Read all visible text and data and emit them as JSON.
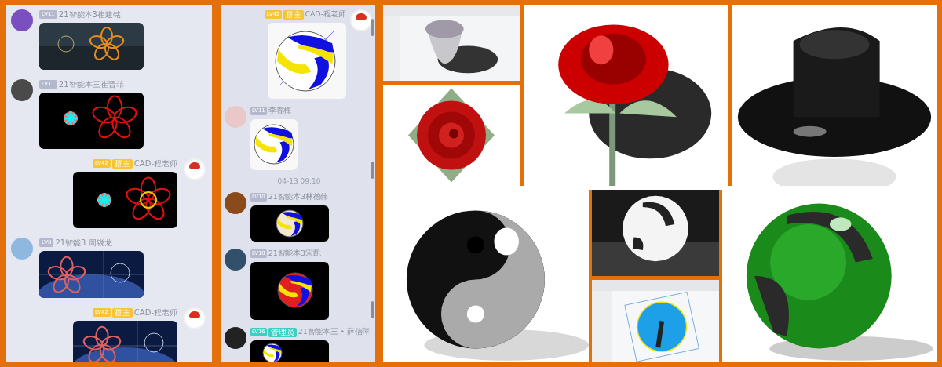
{
  "chats": [
    {
      "messages": [
        {
          "kind": "incoming",
          "rank": "LV11",
          "sender": "21智能本3崔建铭"
        },
        {
          "kind": "incoming",
          "rank": "LV11",
          "sender": "21智能本三崔晋菲"
        },
        {
          "kind": "outgoing",
          "rank": "LV42",
          "role": {
            "label": "群主",
            "color": "#f7c531"
          },
          "sender": "CAD-程老师"
        },
        {
          "kind": "incoming",
          "rank": "LV8",
          "sender": "21智能3 周锐龙"
        },
        {
          "kind": "outgoing",
          "rank": "LV42",
          "role": {
            "label": "群主",
            "color": "#f7c531"
          },
          "sender": "CAD-程老师"
        }
      ]
    },
    {
      "messages": [
        {
          "kind": "outgoing",
          "rank": "LV42",
          "role": {
            "label": "群主",
            "color": "#f7c531"
          },
          "sender": "CAD-程老师"
        },
        {
          "kind": "incoming",
          "rank": "LV11",
          "sender": "李春梅"
        },
        {
          "kind": "time",
          "text": "04-13 09:10"
        },
        {
          "kind": "incoming",
          "rank": "LV10",
          "sender": "21智能本3林德伟"
        },
        {
          "kind": "incoming",
          "rank": "LV10",
          "sender": "21智能本3宋凯"
        },
        {
          "kind": "incoming",
          "rank": "LV16",
          "role": {
            "label": "管理员",
            "color": "#3ccfc4"
          },
          "sender": "21智能本三 • 薛信萍"
        }
      ]
    }
  ]
}
